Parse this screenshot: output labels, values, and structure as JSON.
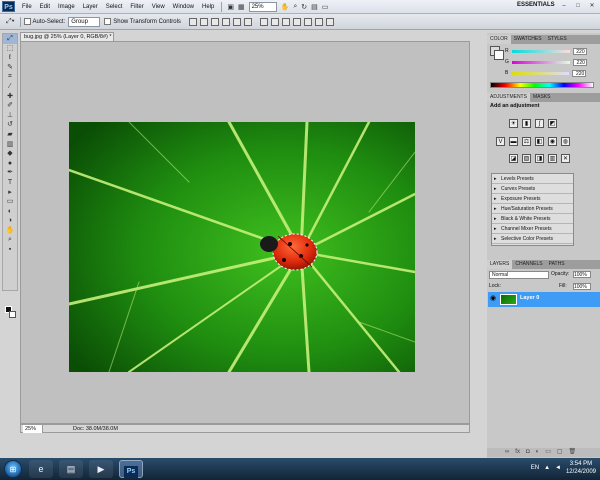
{
  "menubar": {
    "app_logo": "Ps",
    "items": [
      "File",
      "Edit",
      "Image",
      "Layer",
      "Select",
      "Filter",
      "View",
      "Window",
      "Help"
    ],
    "zoom": "25%",
    "workspace": "ESSENTIALS",
    "window_controls": [
      "–",
      "□",
      "✕"
    ]
  },
  "options_bar": {
    "auto_select_label": "Auto-Select:",
    "auto_select_value": "Group",
    "show_transform_label": "Show Transform Controls"
  },
  "document": {
    "tab_title": "bug.jpg @ 25% (Layer 0, RGB/8#) *",
    "status_zoom": "25%",
    "status_doc": "Doc: 38.0M/38.0M"
  },
  "color_panel": {
    "tabs": [
      "COLOR",
      "SWATCHES",
      "STYLES"
    ],
    "channels": [
      {
        "label": "R",
        "value": "220"
      },
      {
        "label": "G",
        "value": "220"
      },
      {
        "label": "B",
        "value": "220"
      }
    ]
  },
  "adjustments_panel": {
    "tabs": [
      "ADJUSTMENTS",
      "MASKS"
    ],
    "title": "Add an adjustment",
    "presets": [
      "Levels Presets",
      "Curves Presets",
      "Exposure Presets",
      "Hue/Saturation Presets",
      "Black & White Presets",
      "Channel Mixer Presets",
      "Selective Color Presets"
    ]
  },
  "layers_panel": {
    "tabs": [
      "LAYERS",
      "CHANNELS",
      "PATHS"
    ],
    "blend_mode": "Normal",
    "opacity_label": "Opacity:",
    "opacity_value": "100%",
    "lock_label": "Lock:",
    "fill_label": "Fill:",
    "fill_value": "100%",
    "layer_name": "Layer 0"
  },
  "taskbar": {
    "language": "EN",
    "time": "3:54 PM",
    "date": "12/24/2009",
    "ps_label": "Ps"
  }
}
